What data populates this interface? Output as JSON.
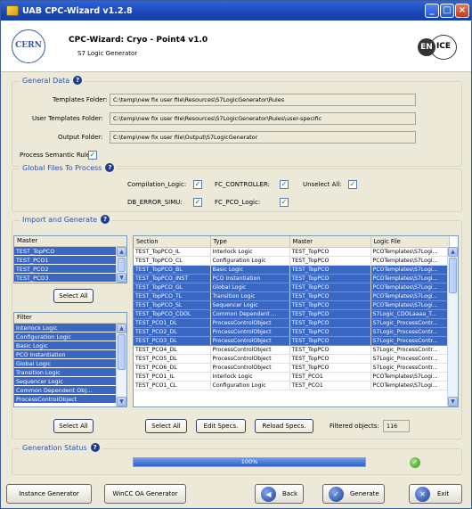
{
  "window": {
    "title": "UAB CPC-Wizard v1.2.8"
  },
  "header": {
    "title": "CPC-Wizard: Cryo - Point4 v1.0",
    "subtitle": "S7 Logic Generator",
    "cern_logo": "CERN",
    "logo_en": "EN",
    "logo_ice": "ICE"
  },
  "general": {
    "legend": "General Data",
    "templates_label": "Templates Folder:",
    "templates_value": "C:\\temp\\new fix user file\\Resources\\S7LogicGenerator\\Rules",
    "user_templates_label": "User Templates Folder:",
    "user_templates_value": "C:\\temp\\new fix user file\\Resources\\S7LogicGenerator\\Rules\\user-specific",
    "output_label": "Output Folder:",
    "output_value": "C:\\temp\\new fix user file\\Output\\S7LogicGenerator",
    "semantic_label": "Process Semantic Rules:"
  },
  "global_files": {
    "legend": "Global Files To Process",
    "items": [
      {
        "label": "Compilation_Logic:",
        "checked": true
      },
      {
        "label": "FC_CONTROLLER:",
        "checked": true
      },
      {
        "label": "Unselect All:",
        "checked": true
      },
      {
        "label": "DB_ERROR_SIMU:",
        "checked": true
      },
      {
        "label": "FC_PCO_Logic:",
        "checked": true
      }
    ]
  },
  "import": {
    "legend": "Import and Generate",
    "master_header": "Master",
    "master_items": [
      "TEST_TopPCO",
      "TEST_PCO1",
      "TEST_PCO2",
      "TEST_PCO3"
    ],
    "master_select_all": "Select All",
    "filter_header": "Filter",
    "filter_items": [
      "Interlock Logic",
      "Configuration Logic",
      "Basic Logic",
      "PCO Instantiation",
      "Global Logic",
      "Transition Logic",
      "Sequencer Logic",
      "Common Dependent Obj...",
      "ProcessControlObject"
    ],
    "filter_select_all": "Select All",
    "columns": [
      "Section",
      "Type",
      "Master",
      "Logic File"
    ],
    "rows": [
      {
        "section": "TEST_TopPCO_IL",
        "type": "Interlock Logic",
        "master": "TEST_TopPCO",
        "file": "PCOTemplates\\S7Logi...",
        "sel": false
      },
      {
        "section": "TEST_TopPCO_CL",
        "type": "Configuration Logic",
        "master": "TEST_TopPCO",
        "file": "PCOTemplates\\S7Logi...",
        "sel": false
      },
      {
        "section": "TEST_TopPCO_BL",
        "type": "Basic Logic",
        "master": "TEST_TopPCO",
        "file": "PCOTemplates\\S7Logi...",
        "sel": true
      },
      {
        "section": "TEST_TopPCO_INST",
        "type": "PCO Instantiation",
        "master": "TEST_TopPCO",
        "file": "PCOTemplates\\S7Logi...",
        "sel": true
      },
      {
        "section": "TEST_TopPCO_GL",
        "type": "Global Logic",
        "master": "TEST_TopPCO",
        "file": "PCOTemplates\\S7Logi...",
        "sel": true
      },
      {
        "section": "TEST_TopPCO_TL",
        "type": "Transition Logic",
        "master": "TEST_TopPCO",
        "file": "PCOTemplates\\S7Logi...",
        "sel": true
      },
      {
        "section": "TEST_TopPCO_SL",
        "type": "Sequencer Logic",
        "master": "TEST_TopPCO",
        "file": "PCOTemplates\\S7Logi...",
        "sel": true
      },
      {
        "section": "TEST_TopPCO_CDOL",
        "type": "Common Dependent ...",
        "master": "TEST_TopPCO",
        "file": "S7Logic_CDOLaaaa_T...",
        "sel": true
      },
      {
        "section": "TEST_PCO1_DL",
        "type": "ProcessControlObject",
        "master": "TEST_TopPCO",
        "file": "S7Logic_ProcessContr...",
        "sel": true
      },
      {
        "section": "TEST_PCO2_DL",
        "type": "ProcessControlObject",
        "master": "TEST_TopPCO",
        "file": "S7Logic_ProcessContr...",
        "sel": true
      },
      {
        "section": "TEST_PCO3_DL",
        "type": "ProcessControlObject",
        "master": "TEST_TopPCO",
        "file": "S7Logic_ProcessContr...",
        "sel": true
      },
      {
        "section": "TEST_PCO4_DL",
        "type": "ProcessControlObject",
        "master": "TEST_TopPCO",
        "file": "S7Logic_ProcessContr...",
        "sel": false
      },
      {
        "section": "TEST_PCO5_DL",
        "type": "ProcessControlObject",
        "master": "TEST_TopPCO",
        "file": "S7Logic_ProcessContr...",
        "sel": false
      },
      {
        "section": "TEST_PCO6_DL",
        "type": "ProcessControlObject",
        "master": "TEST_TopPCO",
        "file": "S7Logic_ProcessContr...",
        "sel": false
      },
      {
        "section": "TEST_PCO1_IL",
        "type": "Interlock Logic",
        "master": "TEST_PCO1",
        "file": "PCOTemplates\\S7Logi...",
        "sel": false
      },
      {
        "section": "TEST_PCO1_CL",
        "type": "Configuration Logic",
        "master": "TEST_PCO1",
        "file": "PCOTemplates\\S7Logi...",
        "sel": false
      }
    ],
    "select_all": "Select All",
    "edit_specs": "Edit Specs.",
    "reload_specs": "Reload Specs.",
    "filtered_label": "Filtered objects:",
    "filtered_count": "116"
  },
  "status": {
    "legend": "Generation Status",
    "progress_text": "100%",
    "progress": 1.0
  },
  "footer": {
    "instance_generator": "Instance Generator",
    "wincc_generator": "WinCC OA Generator",
    "back": "Back",
    "generate": "Generate",
    "exit": "Exit"
  }
}
